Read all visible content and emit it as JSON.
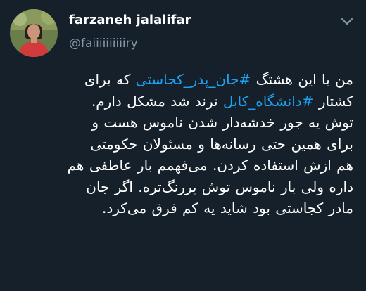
{
  "author": {
    "display_name": "farzaneh jalalifar",
    "handle": "@faiiiiiiiiiiry",
    "avatar_icon": "user-avatar-photo"
  },
  "menu": {
    "icon": "chevron-down-icon"
  },
  "tweet": {
    "line1": {
      "before": "من با این هشتگ ",
      "hashtag": "#جان_پدر_کجاستی",
      "after": " که برای"
    },
    "line2": {
      "before": "کشتار ",
      "hashtag": "#دانشگاه_کابل",
      "after": " ترند شد مشکل دارم."
    },
    "line3": "توش یه جور خدشه‌دار شدن ناموس هست و",
    "line4": "برای همین حتی رسانه‌ها و مسئولان حکومتی",
    "line5": "هم ازش استفاده کردن. می‌فهمم بار عاطفی هم",
    "line6": "داره ولی بار ناموس توش پررنگ‌تره. اگر جان",
    "line7": "مادر کجاستی بود شاید یه کم فرق می‌کرد."
  },
  "colors": {
    "background": "#15202b",
    "text": "#ffffff",
    "secondary": "#8899a6",
    "hashtag": "#1da1f2"
  }
}
